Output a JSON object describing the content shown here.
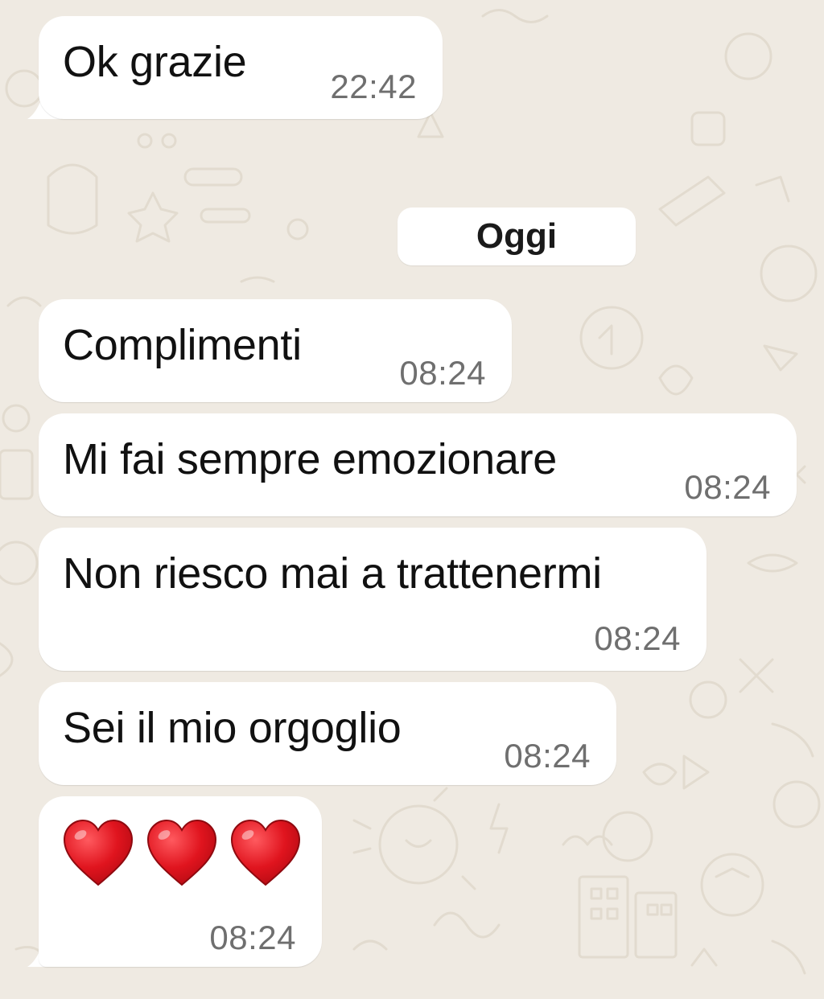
{
  "chat": {
    "date_label": "Oggi",
    "messages": [
      {
        "text": "Ok grazie",
        "time": "22:42"
      },
      {
        "text": "Complimenti",
        "time": "08:24"
      },
      {
        "text": "Mi fai sempre emozionare",
        "time": "08:24"
      },
      {
        "text": "Non riesco mai a trattenermi",
        "time": "08:24"
      },
      {
        "text": "Sei il mio orgoglio",
        "time": "08:24"
      },
      {
        "emoji": [
          "heart-icon",
          "heart-icon",
          "heart-icon"
        ],
        "time": "08:24"
      }
    ]
  },
  "colors": {
    "background": "#efeae2",
    "bubble": "#ffffff",
    "text": "#111111",
    "timestamp": "#6f6f6f",
    "heart": "#e0141e"
  }
}
